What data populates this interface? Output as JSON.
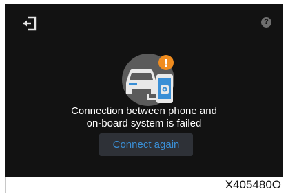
{
  "screen": {
    "message_line1": "Connection between phone and",
    "message_line2": "on-board system is failed",
    "connect_label": "Connect again",
    "exit_icon": "exit-icon",
    "help_icon": "help-icon",
    "help_glyph": "?",
    "warning_glyph": "!"
  },
  "figure": {
    "ref_code": "X405480O"
  },
  "colors": {
    "screen_bg": "#121212",
    "accent_blue": "#3a8fd6",
    "warning_orange": "#f08c1e",
    "button_bg": "#2e3137"
  }
}
